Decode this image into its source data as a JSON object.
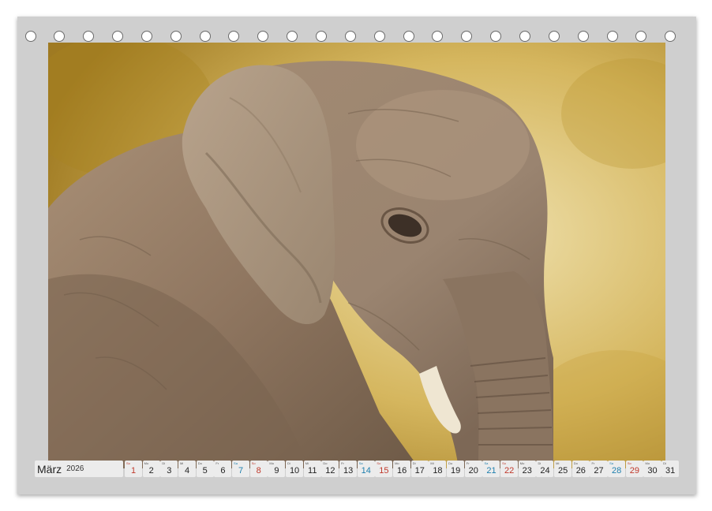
{
  "calendar": {
    "month": "März",
    "year": "2026",
    "days": [
      {
        "wd": "So",
        "d": "1",
        "type": "sun"
      },
      {
        "wd": "Mo",
        "d": "2",
        "type": ""
      },
      {
        "wd": "Di",
        "d": "3",
        "type": ""
      },
      {
        "wd": "Mi",
        "d": "4",
        "type": ""
      },
      {
        "wd": "Do",
        "d": "5",
        "type": ""
      },
      {
        "wd": "Fr",
        "d": "6",
        "type": ""
      },
      {
        "wd": "Sa",
        "d": "7",
        "type": "sat"
      },
      {
        "wd": "So",
        "d": "8",
        "type": "sun"
      },
      {
        "wd": "Mo",
        "d": "9",
        "type": ""
      },
      {
        "wd": "Di",
        "d": "10",
        "type": ""
      },
      {
        "wd": "Mi",
        "d": "11",
        "type": ""
      },
      {
        "wd": "Do",
        "d": "12",
        "type": ""
      },
      {
        "wd": "Fr",
        "d": "13",
        "type": ""
      },
      {
        "wd": "Sa",
        "d": "14",
        "type": "sat"
      },
      {
        "wd": "So",
        "d": "15",
        "type": "sun"
      },
      {
        "wd": "Mo",
        "d": "16",
        "type": ""
      },
      {
        "wd": "Di",
        "d": "17",
        "type": ""
      },
      {
        "wd": "Mi",
        "d": "18",
        "type": ""
      },
      {
        "wd": "Do",
        "d": "19",
        "type": ""
      },
      {
        "wd": "Fr",
        "d": "20",
        "type": ""
      },
      {
        "wd": "Sa",
        "d": "21",
        "type": "sat"
      },
      {
        "wd": "So",
        "d": "22",
        "type": "sun"
      },
      {
        "wd": "Mo",
        "d": "23",
        "type": ""
      },
      {
        "wd": "Di",
        "d": "24",
        "type": ""
      },
      {
        "wd": "Mi",
        "d": "25",
        "type": ""
      },
      {
        "wd": "Do",
        "d": "26",
        "type": ""
      },
      {
        "wd": "Fr",
        "d": "27",
        "type": ""
      },
      {
        "wd": "Sa",
        "d": "28",
        "type": "sat"
      },
      {
        "wd": "So",
        "d": "29",
        "type": "sun"
      },
      {
        "wd": "Mo",
        "d": "30",
        "type": ""
      },
      {
        "wd": "Di",
        "d": "31",
        "type": ""
      }
    ]
  },
  "colors": {
    "saturday": "#1e7fae",
    "sunday": "#c0392b"
  }
}
